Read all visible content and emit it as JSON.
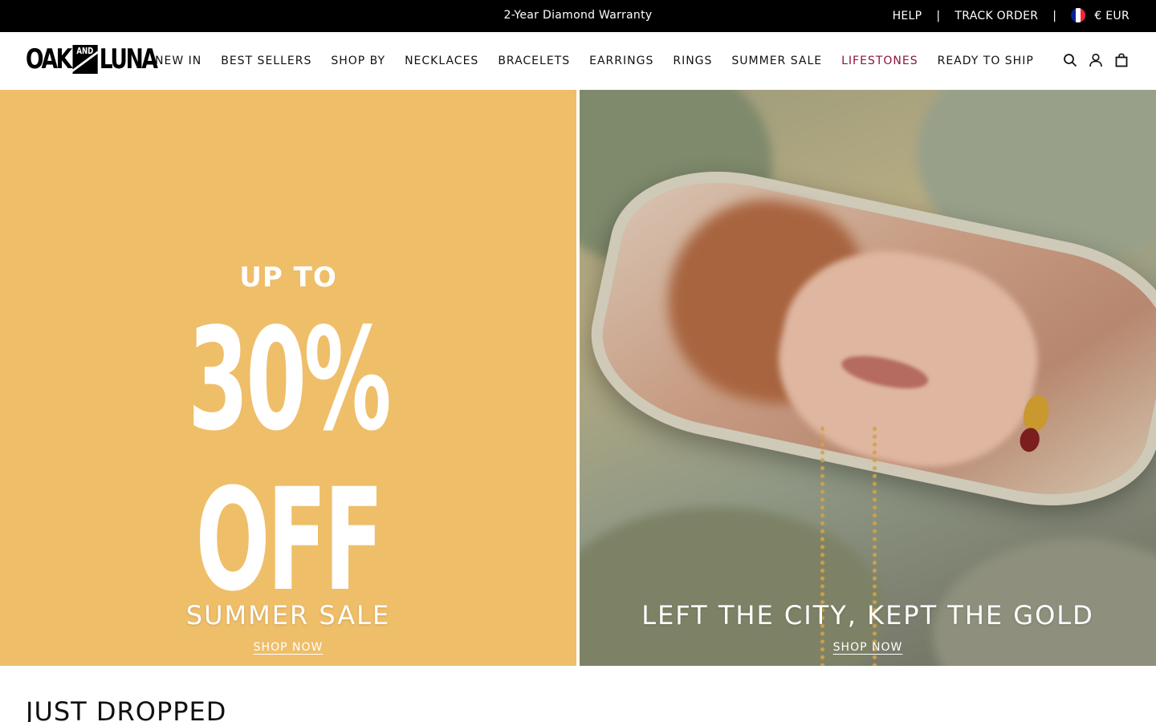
{
  "topbar": {
    "announcement": "2-Year Diamond Warranty",
    "help": "HELP",
    "separator": "|",
    "track_order": "TRACK ORDER",
    "currency": "€ EUR",
    "flag_colors": [
      "#002395",
      "#ffffff",
      "#ed2939"
    ]
  },
  "header": {
    "logo": {
      "left": "OAK",
      "middle": "AND",
      "right": "LUNA"
    },
    "nav": [
      {
        "label": "NEW IN"
      },
      {
        "label": "BEST SELLERS"
      },
      {
        "label": "SHOP BY"
      },
      {
        "label": "NECKLACES"
      },
      {
        "label": "BRACELETS"
      },
      {
        "label": "EARRINGS"
      },
      {
        "label": "RINGS"
      },
      {
        "label": "SUMMER SALE"
      },
      {
        "label": "LIFESTONES",
        "accent_color": "#8a1538"
      },
      {
        "label": "READY TO SHIP"
      }
    ],
    "icons": [
      "search-icon",
      "account-icon",
      "bag-icon"
    ]
  },
  "hero": {
    "left": {
      "background": "#efbe69",
      "promo_line1": "UP TO",
      "promo_line2": "30% OFF",
      "title": "SUMMER SALE",
      "cta": "SHOP NOW"
    },
    "right": {
      "title": "LEFT THE CITY, KEPT THE GOLD",
      "cta": "SHOP NOW"
    }
  },
  "section": {
    "title": "JUST DROPPED"
  }
}
